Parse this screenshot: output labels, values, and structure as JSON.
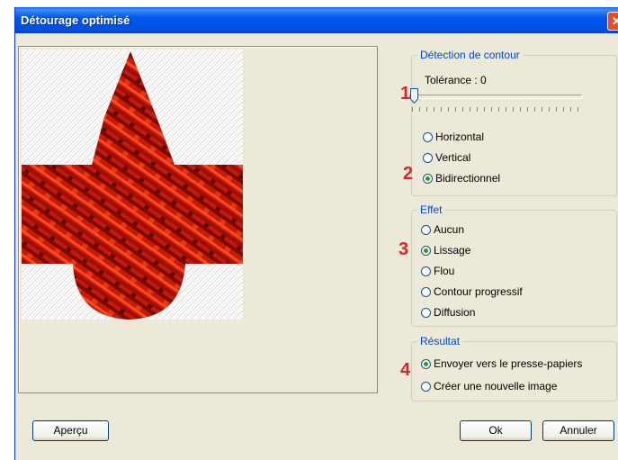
{
  "window": {
    "title": "Détourage optimisé",
    "close_symbol": "✕"
  },
  "detection": {
    "legend": "Détection de contour",
    "tolerance_label": "Tolérance : 0",
    "tolerance_value": 0,
    "options": [
      "Horizontal",
      "Vertical",
      "Bidirectionnel"
    ],
    "selected": "Bidirectionnel"
  },
  "effet": {
    "legend": "Effet",
    "options": [
      "Aucun",
      "Lissage",
      "Flou",
      "Contour progressif",
      "Diffusion"
    ],
    "selected": "Lissage"
  },
  "resultat": {
    "legend": "Résultat",
    "options": [
      "Envoyer vers le presse-papiers",
      "Créer une nouvelle image"
    ],
    "selected": "Envoyer vers le presse-papiers"
  },
  "annotations": [
    "1",
    "2",
    "3",
    "4"
  ],
  "buttons": {
    "apercu": "Aperçu",
    "ok": "Ok",
    "annuler": "Annuler"
  },
  "colors": {
    "accent_red": "#d82626",
    "legend_blue": "#0046d5",
    "shape_red": "#c41a0a"
  }
}
